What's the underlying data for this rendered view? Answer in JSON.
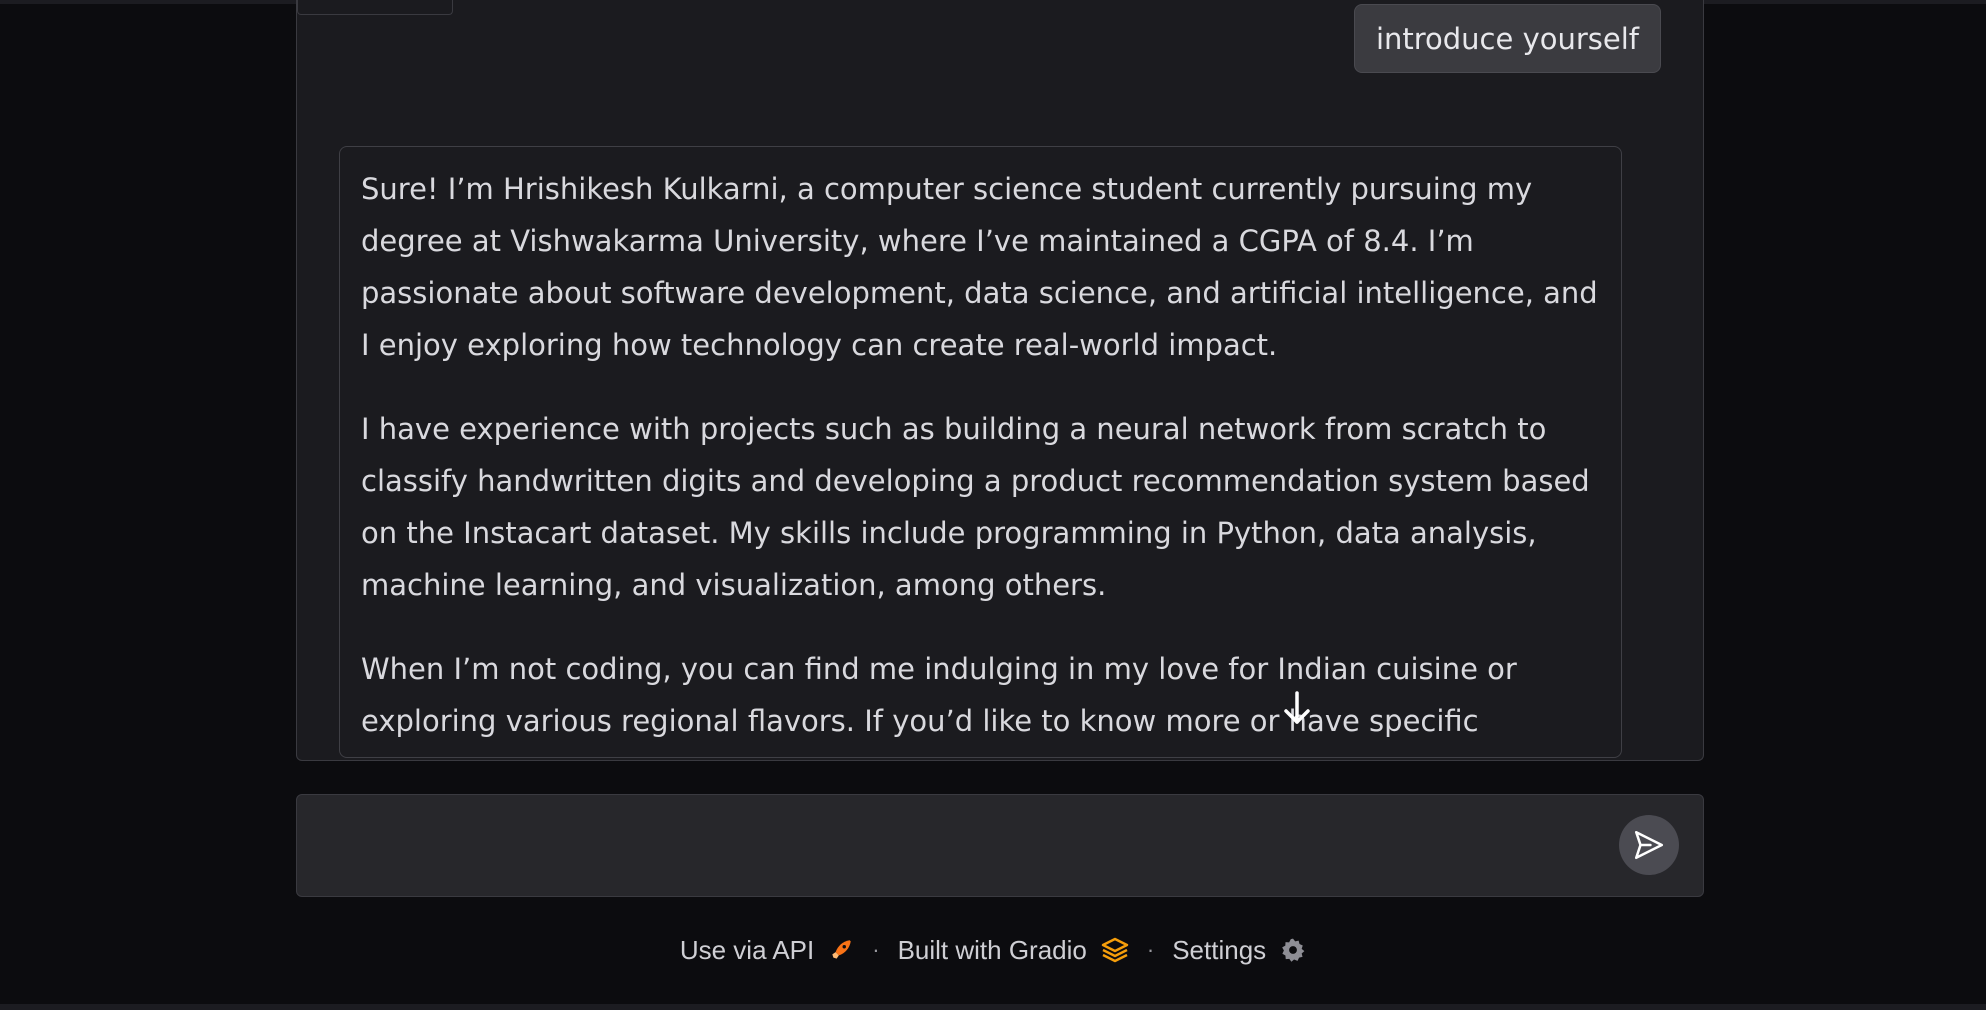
{
  "chat": {
    "user_message": "introduce yourself",
    "bot_paragraphs": [
      "Sure! I’m Hrishikesh Kulkarni, a computer science student currently pursuing my degree at Vishwakarma University, where I’ve maintained a CGPA of 8.4. I’m passionate about software development, data science, and artificial intelligence, and I enjoy exploring how technology can create real-world impact.",
      "I have experience with projects such as building a neural network from scratch to classify handwritten digits and developing a product recommendation system based on the Instacart dataset. My skills include programming in Python, data analysis, machine learning, and visualization, among others.",
      "When I’m not coding, you can find me indulging in my love for Indian cuisine or exploring various regional flavors. If you’d like to know more or have specific questions, feel free to ask!"
    ]
  },
  "input": {
    "placeholder": "",
    "value": ""
  },
  "footer": {
    "api_label": "Use via API",
    "built_label": "Built with Gradio",
    "settings_label": "Settings",
    "separator": "·"
  },
  "colors": {
    "background": "#0c0c0f",
    "panel": "#1b1b1f",
    "user_bubble": "#3b3b40",
    "accent_orange": "#f59e0b"
  },
  "icons": {
    "send": "send-icon",
    "scroll_down": "arrow-down-icon",
    "api": "rocket-icon",
    "gradio": "gradio-logo-icon",
    "settings": "gear-icon"
  }
}
